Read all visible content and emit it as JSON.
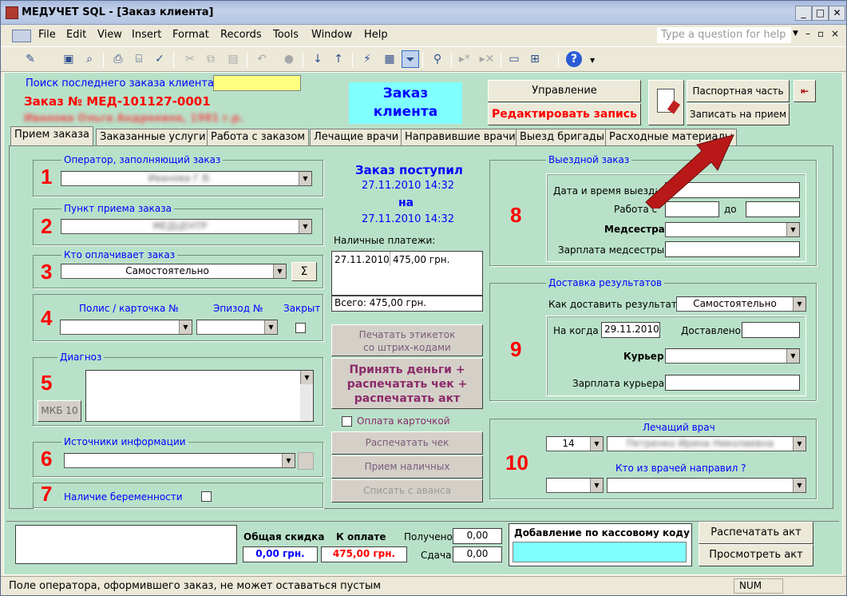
{
  "window": {
    "title": "МЕДУЧЕТ SQL - [Заказ клиента]"
  },
  "menu": [
    "File",
    "Edit",
    "View",
    "Insert",
    "Format",
    "Records",
    "Tools",
    "Window",
    "Help"
  ],
  "help_placeholder": "Type a question for help",
  "header": {
    "search_label": "Поиск последнего заказа клиента",
    "order_no": "Заказ №  МЕД-101127-0001",
    "patient_blur": "Иванова Ольга Андреевна, 1981 г.р.",
    "title": "Заказ клиента",
    "btn_manage": "Управление",
    "btn_edit": "Редактировать запись",
    "btn_passport": "Паспортная часть",
    "btn_appoint": "Записать на прием"
  },
  "tabs": [
    "Прием заказа",
    "Заказанные услуги",
    "Работа с заказом",
    "Лечащие врачи",
    "Направившие врачи",
    "Выезд бригады",
    "Расходные материалы"
  ],
  "sec1": {
    "label": "Оператор, заполняющий заказ",
    "num": "1",
    "value": "Иванова Г.В."
  },
  "sec2": {
    "label": "Пункт приема заказа",
    "num": "2",
    "value": "МЕДЦЕНТР"
  },
  "sec3": {
    "label": "Кто оплачивает заказ",
    "num": "3",
    "value": "Самостоятельно",
    "sigma": "Σ"
  },
  "sec4": {
    "num": "4",
    "polis": "Полис / карточка №",
    "episode": "Эпизод №",
    "closed": "Закрыт"
  },
  "sec5": {
    "label": "Диагноз",
    "num": "5",
    "mkb": "МКБ 10"
  },
  "sec6": {
    "label": "Источники информации",
    "num": "6"
  },
  "sec7": {
    "num": "7",
    "label": "Наличие беременности"
  },
  "middle": {
    "received": "Заказ поступил",
    "d1": "27.11.2010 14:32",
    "on": "на",
    "d2": "27.11.2010 14:32",
    "cash": "Наличные платежи:",
    "pay_date": "27.11.2010",
    "pay_amt": "475,00 грн.",
    "total": "Всего: 475,00 грн.",
    "print_labels": "Печатать этикеток\nсо штрих-кодами",
    "accept": "Принять деньги +\nраспечатать чек +\nраспечатать акт",
    "card": "Оплата карточкой",
    "print_check": "Распечатать чек",
    "cash_in": "Прием наличных",
    "advance": "Списать с аванса"
  },
  "sec8": {
    "label": "Выездной заказ",
    "num": "8",
    "datetime": "Дата и время выезда",
    "work": "Работа с",
    "to": "до",
    "nurse": "Медсестра",
    "salary": "Зарплата медсестры"
  },
  "sec9": {
    "label": "Доставка результатов",
    "num": "9",
    "how": "Как доставить результат?",
    "how_val": "Самостоятельно",
    "when": "На когда",
    "when_val": "29.11.2010",
    "delivered": "Доставлено",
    "courier": "Курьер",
    "courier_salary": "Зарплата курьера"
  },
  "sec10": {
    "label": "Лечащий врач",
    "num": "10",
    "doc_no": "14",
    "doc_name": "Петренко Ирина Николаевна",
    "referrer": "Кто из врачей направил ?"
  },
  "footer": {
    "discount": "Общая скидка",
    "to_pay": "К оплате",
    "received": "Получено",
    "change": "Сдача",
    "discount_val": "0,00 грн.",
    "pay_val": "475,00 грн.",
    "rec_val": "0,00",
    "change_val": "0,00",
    "cash_code": "Добавление по кассовому коду",
    "print_act": "Распечатать акт",
    "view_act": "Просмотреть акт"
  },
  "status": {
    "text": "Поле оператора, оформившего заказ, не может оставаться пустым",
    "num": "NUM"
  },
  "colors": {
    "form_bg": "#b9e1c9",
    "title_cyan": "#80ffff",
    "search_yellow": "#ffff80",
    "accent_red": "#ff0000",
    "accent_blue": "#0000ff"
  }
}
